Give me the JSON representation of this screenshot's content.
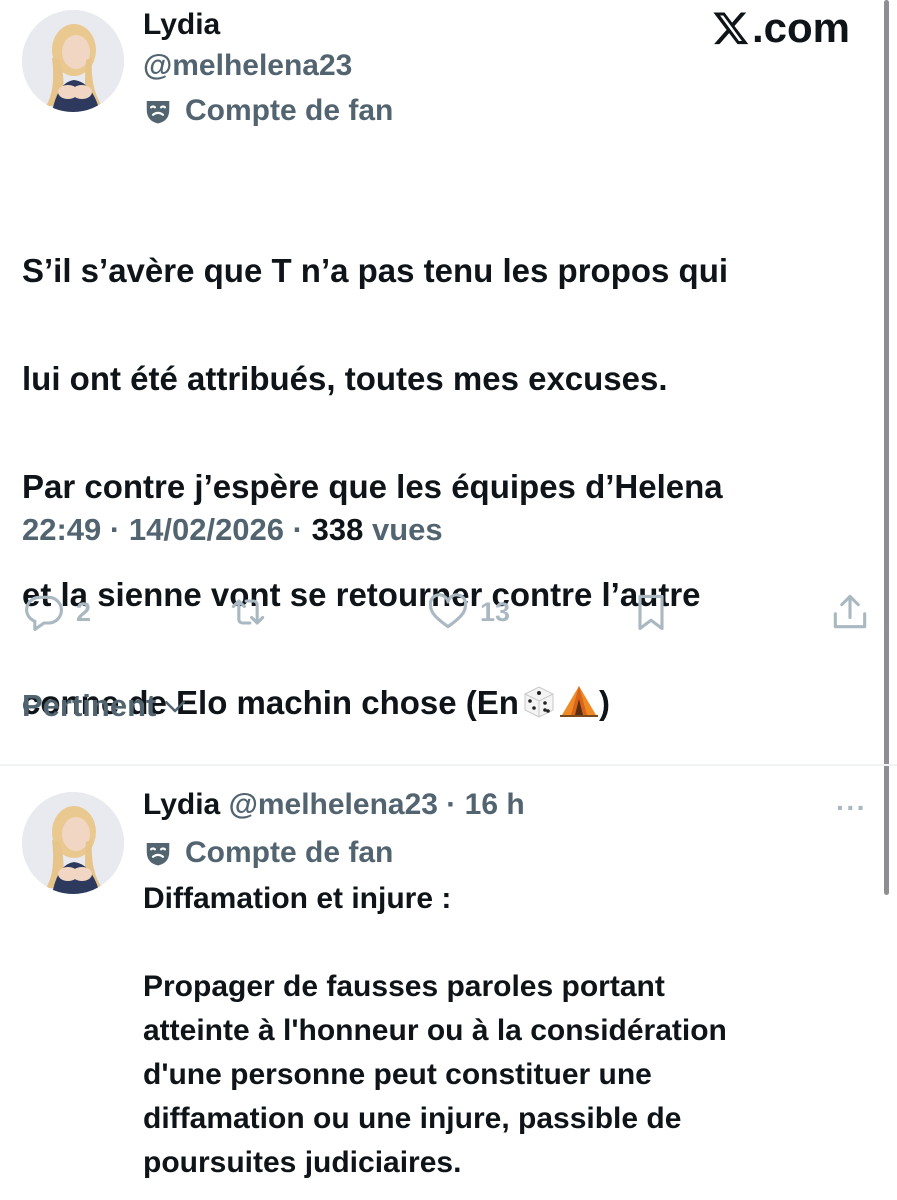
{
  "tweet": {
    "author_name": "Lydia",
    "author_handle": "@melhelena23",
    "badge_label": "Compte de fan",
    "brand": ".com",
    "text_lines": [
      "S’il s’avère que T n’a pas tenu les propos qui",
      "lui ont été attribués, toutes mes excuses.",
      "Par contre j’espère que les équipes d’Helena",
      "et la sienne vont se retourner contre l’autre",
      "conne de Elo machin chose (En",
      ")"
    ],
    "emojis": [
      "dice-icon",
      "tent-icon"
    ],
    "time": "22:49",
    "date": "14/02/2026",
    "views_count": "338",
    "views_label": "vues",
    "separator": "·",
    "actions": {
      "reply_count": "2",
      "retweet_count": "",
      "like_count": "13"
    }
  },
  "sort": {
    "label": "Pertinent"
  },
  "reply": {
    "author_name": "Lydia",
    "author_handle": "@melhelena23",
    "age": "16 h",
    "badge_label": "Compte de fan",
    "more_label": "···",
    "paragraph_1": "Diffamation et injure :",
    "paragraph_2_lines": [
      "Propager de fausses paroles portant",
      "atteinte à l'honneur ou à la considération",
      "d'une personne peut constituer une",
      "diffamation ou une injure, passible de",
      "poursuites judiciaires."
    ]
  },
  "colors": {
    "text_primary": "#0f1419",
    "text_secondary": "#536471",
    "icon_muted": "#aab8c2",
    "divider": "#eff3f4"
  }
}
